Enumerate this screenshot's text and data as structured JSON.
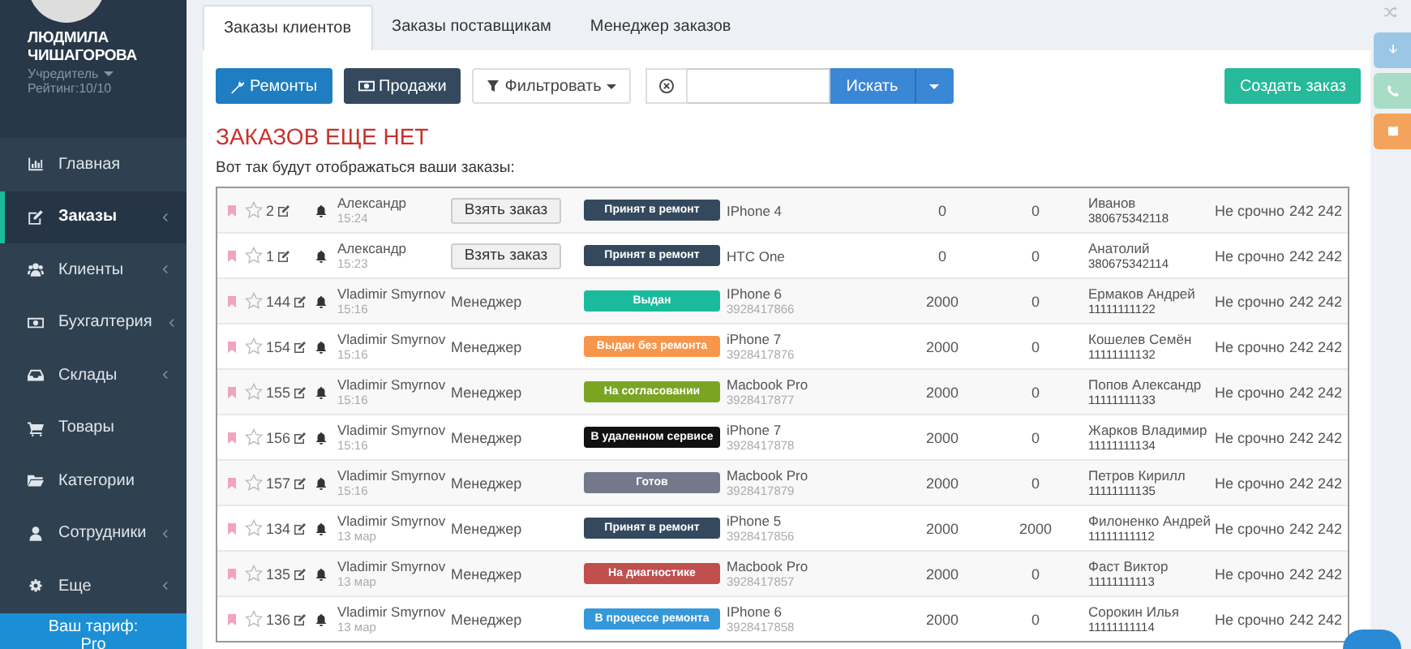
{
  "user": {
    "name": "ЛЮДМИЛА ЧИШАГОРОВА",
    "role": "Учредитель",
    "rating": "Рейтинг:10/10"
  },
  "menu": [
    {
      "kind": "chart",
      "label": "Главная",
      "submenu": false,
      "selected": false
    },
    {
      "kind": "edit",
      "label": "Заказы",
      "submenu": true,
      "selected": true
    },
    {
      "kind": "users",
      "label": "Клиенты",
      "submenu": true,
      "selected": false
    },
    {
      "kind": "money",
      "label": "Бухгалтерия",
      "submenu": true,
      "selected": false
    },
    {
      "kind": "inbox",
      "label": "Склады",
      "submenu": true,
      "selected": false
    },
    {
      "kind": "cart",
      "label": "Товары",
      "submenu": false,
      "selected": false
    },
    {
      "kind": "folder",
      "label": "Категории",
      "submenu": false,
      "selected": false
    },
    {
      "kind": "user",
      "label": "Сотрудники",
      "submenu": true,
      "selected": false
    },
    {
      "kind": "gear",
      "label": "Еще",
      "submenu": true,
      "selected": false
    }
  ],
  "plan": {
    "label": "Ваш тариф:",
    "value": "Pro"
  },
  "tabs": [
    {
      "label": "Заказы клиентов",
      "selected": true
    },
    {
      "label": "Заказы поставщикам",
      "selected": false
    },
    {
      "label": "Менеджер заказов",
      "selected": false
    }
  ],
  "toolbar": {
    "repairs": "Ремонты",
    "sales": "Продажи",
    "filter": "Фильтровать",
    "search_button": "Искать",
    "create": "Создать заказ"
  },
  "heading": "ЗАКАЗОВ ЕЩЕ НЕТ",
  "subtitle": "Вот так будут отображаться ваши заказы:",
  "orders": [
    {
      "number": "2",
      "author": "Александр",
      "time": "15:24",
      "action": {
        "kind": "button",
        "label": "Взять заказ"
      },
      "status": {
        "label": "Принят в ремонт",
        "color": "#34495e"
      },
      "device": "IPhone 4",
      "price": "0",
      "paid": "0",
      "client": "Иванов",
      "phone": "380675342118",
      "urgency": "Не срочно",
      "code": "242 242"
    },
    {
      "number": "1",
      "author": "Александр",
      "time": "15:23",
      "action": {
        "kind": "button",
        "label": "Взять заказ"
      },
      "status": {
        "label": "Принят в ремонт",
        "color": "#34495e"
      },
      "device": "HTC One",
      "price": "0",
      "paid": "0",
      "client": "Анатолий",
      "phone": "380675342114",
      "urgency": "Не срочно",
      "code": "242 242"
    },
    {
      "number": "144",
      "author": "Vladimir Smyrnov",
      "time": "15:16",
      "action": {
        "kind": "text",
        "label": "Менеджер"
      },
      "status": {
        "label": "Выдан",
        "color": "#1abb9c"
      },
      "device": "IPhone 6",
      "serial": "3928417866",
      "price": "2000",
      "paid": "0",
      "client": "Ермаков Андрей",
      "phone": "11111111122",
      "urgency": "Не срочно",
      "code": "242 242"
    },
    {
      "number": "154",
      "author": "Vladimir Smyrnov",
      "time": "15:16",
      "action": {
        "kind": "text",
        "label": "Менеджер"
      },
      "status": {
        "label": "Выдан без ремонта",
        "color": "#f7964a"
      },
      "device": "iPhone 7",
      "serial": "3928417876",
      "price": "2000",
      "paid": "0",
      "client": "Кошелев Семён",
      "phone": "11111111132",
      "urgency": "Не срочно",
      "code": "242 242"
    },
    {
      "number": "155",
      "author": "Vladimir Smyrnov",
      "time": "15:16",
      "action": {
        "kind": "text",
        "label": "Менеджер"
      },
      "status": {
        "label": "На согласовании",
        "color": "#7aa523"
      },
      "device": "Macbook Pro",
      "serial": "3928417877",
      "price": "2000",
      "paid": "0",
      "client": "Попов Александр",
      "phone": "11111111133",
      "urgency": "Не срочно",
      "code": "242 242"
    },
    {
      "number": "156",
      "author": "Vladimir Smyrnov",
      "time": "15:16",
      "action": {
        "kind": "text",
        "label": "Менеджер"
      },
      "status": {
        "label": "В удаленном сервисе",
        "color": "#111111"
      },
      "device": "iPhone 7",
      "serial": "3928417878",
      "price": "2000",
      "paid": "0",
      "client": "Жарков Владимир",
      "phone": "11111111134",
      "urgency": "Не срочно",
      "code": "242 242"
    },
    {
      "number": "157",
      "author": "Vladimir Smyrnov",
      "time": "15:16",
      "action": {
        "kind": "text",
        "label": "Менеджер"
      },
      "status": {
        "label": "Готов",
        "color": "#73798a"
      },
      "device": "Macbook Pro",
      "serial": "3928417879",
      "price": "2000",
      "paid": "0",
      "client": "Петров Кирилл",
      "phone": "11111111135",
      "urgency": "Не срочно",
      "code": "242 242"
    },
    {
      "number": "134",
      "author": "Vladimir Smyrnov",
      "time": "13 мар",
      "action": {
        "kind": "text",
        "label": "Менеджер"
      },
      "status": {
        "label": "Принят в ремонт",
        "color": "#34495e"
      },
      "device": "iPhone 5",
      "serial": "3928417856",
      "price": "2000",
      "paid": "2000",
      "client": "Филоненко Андрей",
      "phone": "11111111112",
      "urgency": "Не срочно",
      "code": "242 242"
    },
    {
      "number": "135",
      "author": "Vladimir Smyrnov",
      "time": "13 мар",
      "action": {
        "kind": "text",
        "label": "Менеджер"
      },
      "status": {
        "label": "На диагностике",
        "color": "#c0504d"
      },
      "device": "Macbook Pro",
      "serial": "3928417857",
      "price": "2000",
      "paid": "0",
      "client": "Фаст Виктор",
      "phone": "11111111113",
      "urgency": "Не срочно",
      "code": "242 242"
    },
    {
      "number": "136",
      "author": "Vladimir Smyrnov",
      "time": "13 мар",
      "action": {
        "kind": "text",
        "label": "Менеджер"
      },
      "status": {
        "label": "В процессе ремонта",
        "color": "#3498db"
      },
      "device": "IPhone 6",
      "serial": "3928417858",
      "price": "2000",
      "paid": "0",
      "client": "Сорокин Илья",
      "phone": "11111111114",
      "urgency": "Не срочно",
      "code": "242 242"
    }
  ]
}
